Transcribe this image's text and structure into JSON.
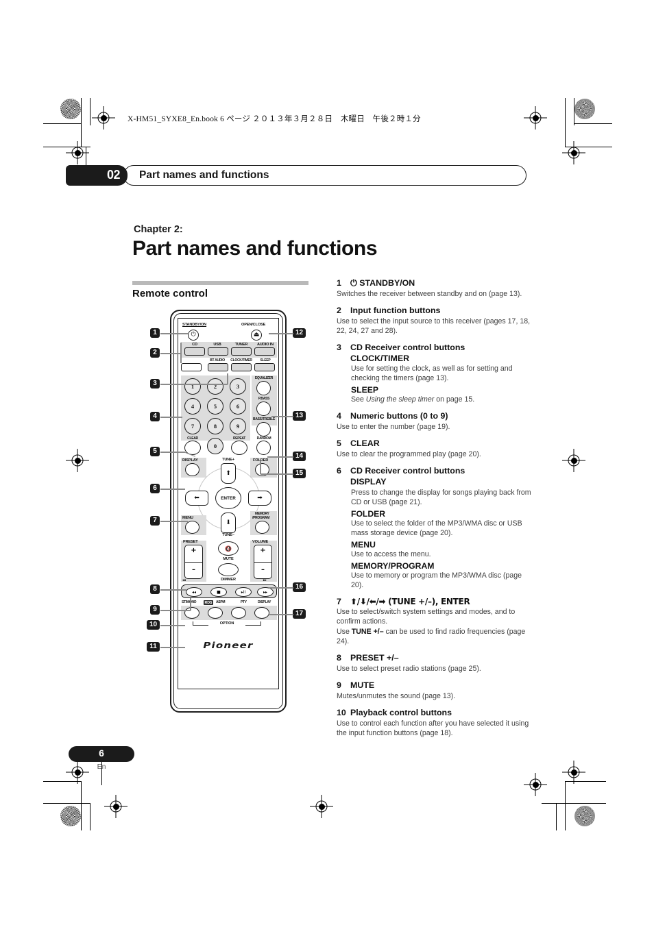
{
  "print_header": "X-HM51_SYXE8_En.book  6 ページ  ２０１３年３月２８日　木曜日　午後２時１分",
  "chapter_tab": {
    "number": "02",
    "title": "Part names and functions"
  },
  "chapter": {
    "label": "Chapter 2:",
    "title": "Part names and functions"
  },
  "section": {
    "heading": "Remote control"
  },
  "footer": {
    "page": "6",
    "lang": "En"
  },
  "remote": {
    "brand": "Pioneer",
    "labels": {
      "standby": "STANDBY/ON",
      "open_close": "OPEN/CLOSE",
      "cd": "CD",
      "usb": "USB",
      "tuner": "TUNER",
      "audio_in": "AUDIO IN",
      "bt_audio": "BT AUDIO",
      "clock_timer": "CLOCK/TIMER",
      "sleep": "SLEEP",
      "equalizer": "EQUALIZER",
      "p_bass": "P.BASS",
      "bass_treble": "BASS/TREBLE",
      "clear": "CLEAR",
      "repeat": "REPEAT",
      "random": "RANDOM",
      "display": "DISPLAY",
      "tune_plus": "TUNE+",
      "tune_minus": "TUNE–",
      "folder": "FOLDER",
      "enter": "ENTER",
      "menu": "MENU",
      "memory_program_1": "MEMORY",
      "memory_program_2": "/PROGRAM",
      "preset": "PRESET",
      "volume": "VOLUME",
      "mute": "MUTE",
      "dimmer": "DIMMER",
      "st_mono": "ST/MONO",
      "rds": "RDS",
      "aspm": "ASPM",
      "pty": "PTY",
      "display2": "DISPLAY",
      "option": "OPTION",
      "plus": "+",
      "minus": "–",
      "rew_mark": "◂◂",
      "ff_mark": "▸▸"
    },
    "numeric_keys": [
      "1",
      "2",
      "3",
      "4",
      "5",
      "6",
      "7",
      "8",
      "9",
      "0"
    ],
    "callouts": [
      "1",
      "2",
      "3",
      "4",
      "5",
      "6",
      "7",
      "8",
      "9",
      "10",
      "11",
      "12",
      "13",
      "14",
      "15",
      "16",
      "17"
    ]
  },
  "items": [
    {
      "num": "1",
      "title": "⏻ STANDBY/ON",
      "body": "Switches the receiver between standby and on (page 13)."
    },
    {
      "num": "2",
      "title": "Input function buttons",
      "body": "Use to select the input source to this receiver (pages 17, 18, 22, 24, 27 and 28)."
    },
    {
      "num": "3",
      "title": "CD Receiver control buttons",
      "title2": "CLOCK/TIMER",
      "subs": [
        {
          "body": "Use for setting the clock, as well as for setting and checking the timers (page 13)."
        },
        {
          "head": "SLEEP",
          "body_pre": "See ",
          "body_ital": "Using the sleep timer",
          "body_post": " on page 15."
        }
      ]
    },
    {
      "num": "4",
      "title": "Numeric buttons (0 to 9)",
      "body": "Use to enter the number (page 19)."
    },
    {
      "num": "5",
      "title": "CLEAR",
      "body": "Use to clear the programmed play (page 20)."
    },
    {
      "num": "6",
      "title": "CD Receiver control buttons",
      "title2": "DISPLAY",
      "subs": [
        {
          "body": "Press to change the display for songs playing back from CD or USB (page 21)."
        },
        {
          "head": "FOLDER",
          "body": "Use to select the folder of the MP3/WMA disc or USB mass storage device (page 20)."
        },
        {
          "head": "MENU",
          "body": "Use to access the menu."
        },
        {
          "head": "MEMORY/PROGRAM",
          "body": "Use to memory or program the MP3/WMA disc (page 20)."
        }
      ]
    },
    {
      "num": "7",
      "title": "⬆/⬇/⬅/➡ (TUNE +/–), ENTER",
      "body": "Use to select/switch system settings and modes, and to confirm actions.",
      "body2_pre": "Use ",
      "body2_bold": "TUNE +/–",
      "body2_post": " can be used to find radio frequencies (page 24)."
    },
    {
      "num": "8",
      "title": "PRESET +/–",
      "body": "Use to select preset radio stations (page 25)."
    },
    {
      "num": "9",
      "title": "MUTE",
      "body": "Mutes/unmutes the sound (page 13)."
    },
    {
      "num": "10",
      "title": "Playback control buttons",
      "body": "Use to control each function after you have selected it using the input function buttons (page 18)."
    }
  ]
}
